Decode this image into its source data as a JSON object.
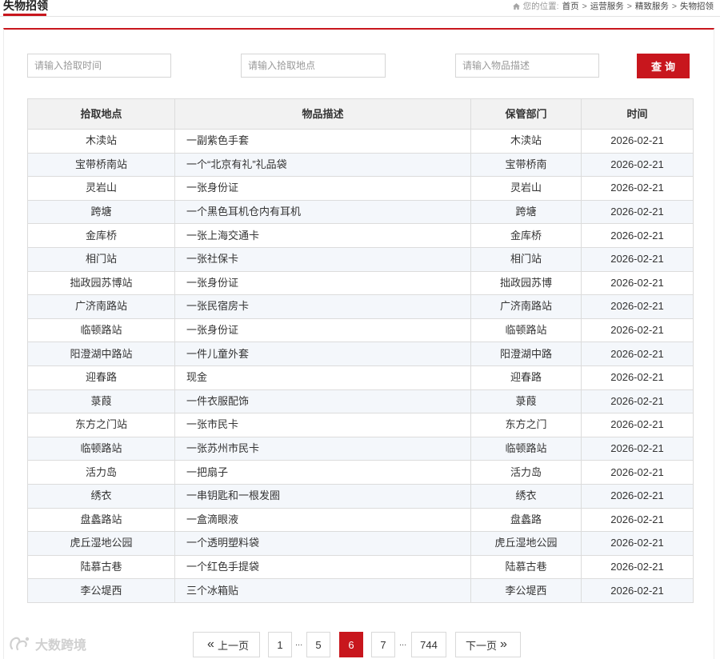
{
  "header": {
    "title": "失物招领",
    "breadcrumb_label": "您的位置:",
    "breadcrumb": [
      "首页",
      "运营服务",
      "精致服务",
      "失物招领"
    ],
    "separator": ">"
  },
  "search": {
    "time_placeholder": "请输入拾取时间",
    "place_placeholder": "请输入拾取地点",
    "desc_placeholder": "请输入物品描述",
    "button_label": "查询"
  },
  "table": {
    "columns": [
      "拾取地点",
      "物品描述",
      "保管部门",
      "时间"
    ],
    "rows": [
      {
        "place": "木渎站",
        "desc": "一副紫色手套",
        "dept": "木渎站",
        "time": "2026-02-21"
      },
      {
        "place": "宝带桥南站",
        "desc": "一个“北京有礼”礼品袋",
        "dept": "宝带桥南",
        "time": "2026-02-21"
      },
      {
        "place": "灵岩山",
        "desc": "一张身份证",
        "dept": "灵岩山",
        "time": "2026-02-21"
      },
      {
        "place": "跨塘",
        "desc": "一个黑色耳机仓内有耳机",
        "dept": "跨塘",
        "time": "2026-02-21"
      },
      {
        "place": "金库桥",
        "desc": "一张上海交通卡",
        "dept": "金库桥",
        "time": "2026-02-21"
      },
      {
        "place": "相门站",
        "desc": "一张社保卡",
        "dept": "相门站",
        "time": "2026-02-21"
      },
      {
        "place": "拙政园苏博站",
        "desc": "一张身份证",
        "dept": "拙政园苏博",
        "time": "2026-02-21"
      },
      {
        "place": "广济南路站",
        "desc": "一张民宿房卡",
        "dept": "广济南路站",
        "time": "2026-02-21"
      },
      {
        "place": "临顿路站",
        "desc": "一张身份证",
        "dept": "临顿路站",
        "time": "2026-02-21"
      },
      {
        "place": "阳澄湖中路站",
        "desc": "一件儿童外套",
        "dept": "阳澄湖中路",
        "time": "2026-02-21"
      },
      {
        "place": "迎春路",
        "desc": "现金",
        "dept": "迎春路",
        "time": "2026-02-21"
      },
      {
        "place": "菉葭",
        "desc": "一件衣服配饰",
        "dept": "菉葭",
        "time": "2026-02-21"
      },
      {
        "place": "东方之门站",
        "desc": "一张市民卡",
        "dept": "东方之门",
        "time": "2026-02-21"
      },
      {
        "place": "临顿路站",
        "desc": "一张苏州市民卡",
        "dept": "临顿路站",
        "time": "2026-02-21"
      },
      {
        "place": "活力岛",
        "desc": "一把扇子",
        "dept": "活力岛",
        "time": "2026-02-21"
      },
      {
        "place": "绣衣",
        "desc": "一串钥匙和一根发圈",
        "dept": "绣衣",
        "time": "2026-02-21"
      },
      {
        "place": "盘蠡路站",
        "desc": "一盒滴眼液",
        "dept": "盘蠡路",
        "time": "2026-02-21"
      },
      {
        "place": "虎丘湿地公园",
        "desc": "一个透明塑料袋",
        "dept": "虎丘湿地公园",
        "time": "2026-02-21"
      },
      {
        "place": "陆慕古巷",
        "desc": "一个红色手提袋",
        "dept": "陆慕古巷",
        "time": "2026-02-21"
      },
      {
        "place": "李公堤西",
        "desc": "三个冰箱贴",
        "dept": "李公堤西",
        "time": "2026-02-21"
      }
    ]
  },
  "pagination": {
    "prev_label": "上一页",
    "next_label": "下一页",
    "prev_arrow": "«",
    "next_arrow": "»",
    "ellipsis": "...",
    "pages": [
      "1",
      "5",
      "6",
      "7",
      "744"
    ],
    "current": "6"
  },
  "watermark": {
    "text": "大数跨境"
  },
  "colors": {
    "accent": "#c8161d",
    "row_alt": "#f4f7fb",
    "header_bg": "#f2f2f2"
  }
}
